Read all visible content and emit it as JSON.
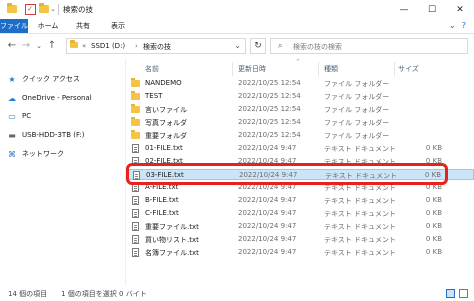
{
  "title": {
    "text": "検索の技"
  },
  "window": {
    "minimize": "—",
    "maximize": "☐",
    "close": "✕"
  },
  "ribbon": {
    "tabs": [
      "ファイル",
      "ホーム",
      "共有",
      "表示"
    ],
    "chevron": "⌄",
    "help": "?"
  },
  "nav": {
    "back": "←",
    "forward": "→",
    "up_dropdown": "⌄",
    "up": "↑",
    "address": {
      "prefix": "«",
      "drive": "SSD1 (D:)",
      "sep": "›",
      "folder": "検索の技",
      "dropdown": "⌄"
    },
    "refresh": "↻",
    "search_placeholder": "検索の技の検索"
  },
  "sidebar": {
    "items": [
      {
        "label": "クイック アクセス",
        "icon": "star-icon",
        "glyph": "★"
      },
      {
        "label": "OneDrive - Personal",
        "icon": "cloud-icon",
        "glyph": "☁"
      },
      {
        "label": "PC",
        "icon": "pc-icon",
        "glyph": "▭"
      },
      {
        "label": "USB-HDD-3TB (F:)",
        "icon": "drive-icon",
        "glyph": "▬"
      },
      {
        "label": "ネットワーク",
        "icon": "network-icon",
        "glyph": "⌘"
      }
    ]
  },
  "columns": {
    "name": "名前",
    "date": "更新日時",
    "type": "種類",
    "size": "サイズ",
    "sort_indicator": "^"
  },
  "files": [
    {
      "name": "NANDEMO",
      "date": "2022/10/25 12:54",
      "type": "ファイル フォルダー",
      "size": "",
      "kind": "folder"
    },
    {
      "name": "TEST",
      "date": "2022/10/25 12:54",
      "type": "ファイル フォルダー",
      "size": "",
      "kind": "folder"
    },
    {
      "name": "言いファイル",
      "date": "2022/10/25 12:54",
      "type": "ファイル フォルダー",
      "size": "",
      "kind": "folder"
    },
    {
      "name": "写真フォルダ",
      "date": "2022/10/25 12:54",
      "type": "ファイル フォルダー",
      "size": "",
      "kind": "folder"
    },
    {
      "name": "重要フォルダ",
      "date": "2022/10/25 12:54",
      "type": "ファイル フォルダー",
      "size": "",
      "kind": "folder"
    },
    {
      "name": "01-FILE.txt",
      "date": "2022/10/24 9:47",
      "type": "テキスト ドキュメント",
      "size": "0 KB",
      "kind": "txt"
    },
    {
      "name": "02-FILE.txt",
      "date": "2022/10/24 9:47",
      "type": "テキスト ドキュメント",
      "size": "0 KB",
      "kind": "txt"
    },
    {
      "name": "03-FILE.txt",
      "date": "2022/10/24 9:47",
      "type": "テキスト ドキュメント",
      "size": "0 KB",
      "kind": "txt"
    },
    {
      "name": "A-FILE.txt",
      "date": "2022/10/24 9:47",
      "type": "テキスト ドキュメント",
      "size": "0 KB",
      "kind": "txt"
    },
    {
      "name": "B-FILE.txt",
      "date": "2022/10/24 9:47",
      "type": "テキスト ドキュメント",
      "size": "0 KB",
      "kind": "txt"
    },
    {
      "name": "C-FILE.txt",
      "date": "2022/10/24 9:47",
      "type": "テキスト ドキュメント",
      "size": "0 KB",
      "kind": "txt"
    },
    {
      "name": "重要ファイル.txt",
      "date": "2022/10/24 9:47",
      "type": "テキスト ドキュメント",
      "size": "0 KB",
      "kind": "txt"
    },
    {
      "name": "買い物リスト.txt",
      "date": "2022/10/24 9:47",
      "type": "テキスト ドキュメント",
      "size": "0 KB",
      "kind": "txt"
    },
    {
      "name": "名簿ファイル.txt",
      "date": "2022/10/24 9:47",
      "type": "テキスト ドキュメント",
      "size": "0 KB",
      "kind": "txt"
    }
  ],
  "status": {
    "text": "14 個の項目　　1 個の項目を選択 0 バイト"
  },
  "colors": {
    "accent": "#1e6ec8",
    "selection": "#cce4f7",
    "highlight": "#e5221b",
    "folder": "#f4c543"
  }
}
